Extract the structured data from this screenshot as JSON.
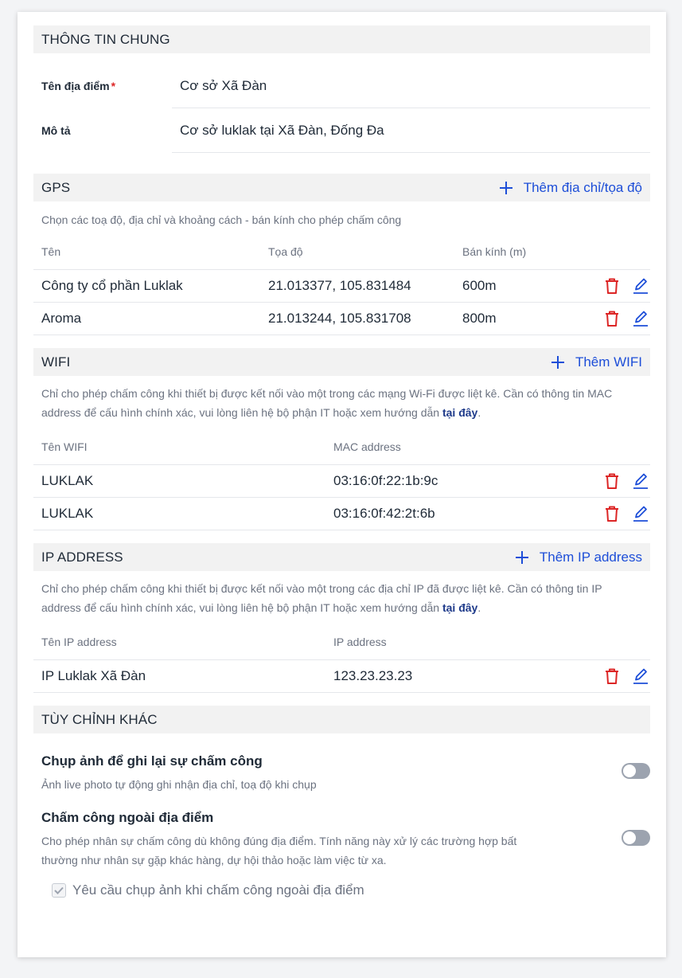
{
  "general": {
    "title": "THÔNG TIN CHUNG",
    "name_label": "Tên địa điểm",
    "required_mark": "*",
    "name_value": "Cơ sở Xã Đàn",
    "desc_label": "Mô tả",
    "desc_value": "Cơ sở luklak tại Xã Đàn, Đống Đa"
  },
  "gps": {
    "title": "GPS",
    "add_label": "Thêm địa chỉ/tọa độ",
    "description": "Chọn các toạ độ, địa chỉ và khoảng cách - bán kính cho phép chấm công",
    "columns": [
      "Tên",
      "Tọa độ",
      "Bán kính (m)"
    ],
    "rows": [
      {
        "name": "Công ty cổ phần Luklak",
        "coords": "21.013377, 105.831484",
        "radius": "600m"
      },
      {
        "name": "Aroma",
        "coords": "21.013244, 105.831708",
        "radius": "800m"
      }
    ]
  },
  "wifi": {
    "title": "WIFI",
    "add_label": "Thêm WIFI",
    "description": "Chỉ cho phép chấm công khi thiết bị được kết nối vào một trong các mạng Wi-Fi được liệt kê. Cần có thông tin MAC address để cấu hình chính xác, vui lòng liên hệ bộ phận IT hoặc xem hướng dẫn ",
    "link": "tại đây",
    "end": ".",
    "columns": [
      "Tên WIFI",
      "MAC address"
    ],
    "rows": [
      {
        "name": "LUKLAK",
        "mac": "03:16:0f:22:1b:9c"
      },
      {
        "name": "LUKLAK",
        "mac": "03:16:0f:42:2t:6b"
      }
    ]
  },
  "ip": {
    "title": "IP ADDRESS",
    "add_label": "Thêm IP address",
    "description": "Chỉ cho phép chấm công khi thiết bị được kết nối vào một trong các địa chỉ IP đã được liệt kê. Cần có thông tin IP address để cấu hình chính xác, vui lòng liên hệ bộ phận IT hoặc xem hướng dẫn ",
    "link": "tại đây",
    "end": ".",
    "columns": [
      "Tên IP address",
      "IP address"
    ],
    "rows": [
      {
        "name": "IP Luklak Xã Đàn",
        "ip": "123.23.23.23"
      }
    ]
  },
  "custom": {
    "title": "TÙY CHỈNH KHÁC",
    "photo_title": "Chụp ảnh để ghi lại sự chấm công",
    "photo_desc": "Ảnh live photo tự động ghi nhận địa chỉ, toạ độ khi chụp",
    "photo_enabled": false,
    "outside_title": "Chấm công ngoài địa điểm",
    "outside_desc": "Cho phép nhân sự chấm công dù không đúng địa điểm. Tính năng này xử lý các trường hợp bất thường như nhân sự gặp khác hàng, dự hội thảo hoặc làm việc từ xa.",
    "outside_enabled": false,
    "checkbox_label": "Yêu cầu chụp ảnh khi chấm công ngoài địa điểm",
    "checkbox_checked": true
  },
  "colors": {
    "accent": "#1d4ed8",
    "delete": "#dc2626",
    "section_bg": "#f2f2f2"
  },
  "icons": {
    "add": "plus-icon",
    "delete": "trash-icon",
    "edit": "pencil-icon",
    "check": "check-icon"
  }
}
